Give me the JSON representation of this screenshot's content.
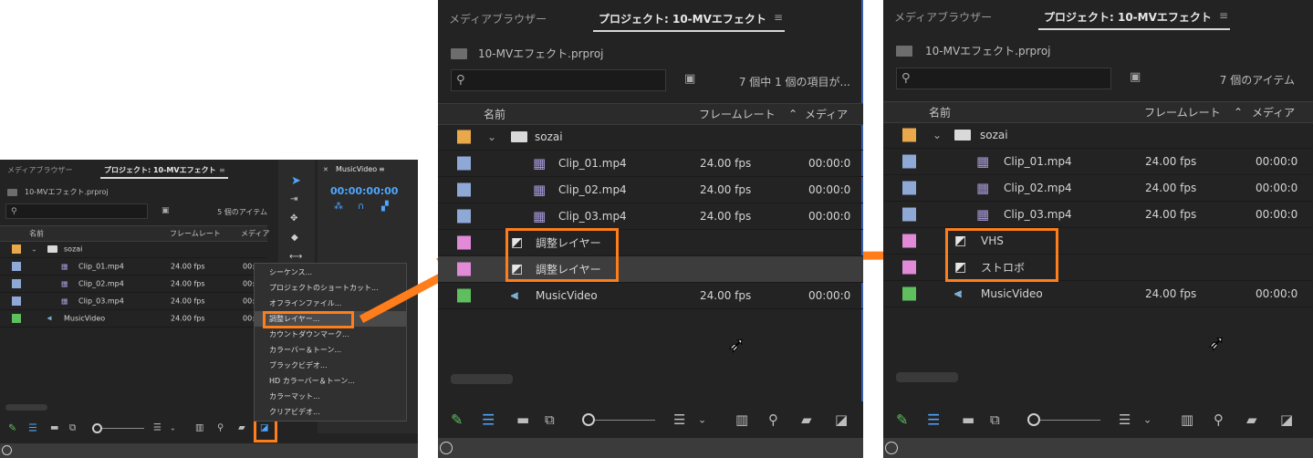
{
  "tabs": {
    "media_browser": "メディアブラウザー",
    "project": "プロジェクト: 10-MVエフェクト",
    "menu": "≡"
  },
  "project_file": "10-MVエフェクト.prproj",
  "columns": {
    "name": "名前",
    "framerate": "フレームレート",
    "media": "メディア"
  },
  "left": {
    "count": "5 個のアイテム",
    "rows": [
      {
        "name": "sozai",
        "fps": "",
        "media": ""
      },
      {
        "name": "Clip_01.mp4",
        "fps": "24.00 fps",
        "media": "00:00:0"
      },
      {
        "name": "Clip_02.mp4",
        "fps": "24.00 fps",
        "media": "00:00:0"
      },
      {
        "name": "Clip_03.mp4",
        "fps": "24.00 fps",
        "media": "00:00:0"
      },
      {
        "name": "MusicVideo",
        "fps": "24.00 fps",
        "media": "00:00:0"
      }
    ],
    "timeline_tab": "MusicVideo",
    "timecode": "00:00:00:00"
  },
  "context_menu": {
    "items": [
      "シーケンス...",
      "プロジェクトのショートカット...",
      "オフラインファイル...",
      "調整レイヤー...",
      "カウントダウンマーク...",
      "カラーバー＆トーン...",
      "ブラックビデオ...",
      "HD カラーバー＆トーン...",
      "カラーマット...",
      "クリアビデオ..."
    ]
  },
  "middle": {
    "count": "7 個中 1 個の項目が...",
    "rows": [
      {
        "name": "sozai",
        "fps": "",
        "media": ""
      },
      {
        "name": "Clip_01.mp4",
        "fps": "24.00 fps",
        "media": "00:00:0"
      },
      {
        "name": "Clip_02.mp4",
        "fps": "24.00 fps",
        "media": "00:00:0"
      },
      {
        "name": "Clip_03.mp4",
        "fps": "24.00 fps",
        "media": "00:00:0"
      },
      {
        "name": "調整レイヤー",
        "fps": "",
        "media": ""
      },
      {
        "name": "調整レイヤー",
        "fps": "",
        "media": ""
      },
      {
        "name": "MusicVideo",
        "fps": "24.00 fps",
        "media": "00:00:0"
      }
    ]
  },
  "right": {
    "count": "7 個のアイテム",
    "rows": [
      {
        "name": "sozai",
        "fps": "",
        "media": ""
      },
      {
        "name": "Clip_01.mp4",
        "fps": "24.00 fps",
        "media": "00:00:0"
      },
      {
        "name": "Clip_02.mp4",
        "fps": "24.00 fps",
        "media": "00:00:0"
      },
      {
        "name": "Clip_03.mp4",
        "fps": "24.00 fps",
        "media": "00:00:0"
      },
      {
        "name": "VHS",
        "fps": "",
        "media": ""
      },
      {
        "name": "ストロボ",
        "fps": "",
        "media": ""
      },
      {
        "name": "MusicVideo",
        "fps": "24.00 fps",
        "media": "00:00:0"
      }
    ]
  },
  "label_colors": {
    "bin": "#e9a84c",
    "clip": "#8fa9d6",
    "adjustment": "#e08ad8",
    "sequence": "#5fbf5f"
  },
  "accent": "#ff7d1a",
  "icons": {
    "project": "bin-icon",
    "search": "magnifier-icon",
    "new_bin": "new-bin-icon",
    "folder": "folder-icon",
    "clip": "video-clip-icon",
    "adjustment": "adjustment-layer-icon",
    "sequence": "sequence-icon",
    "new_item": "new-item-icon"
  }
}
